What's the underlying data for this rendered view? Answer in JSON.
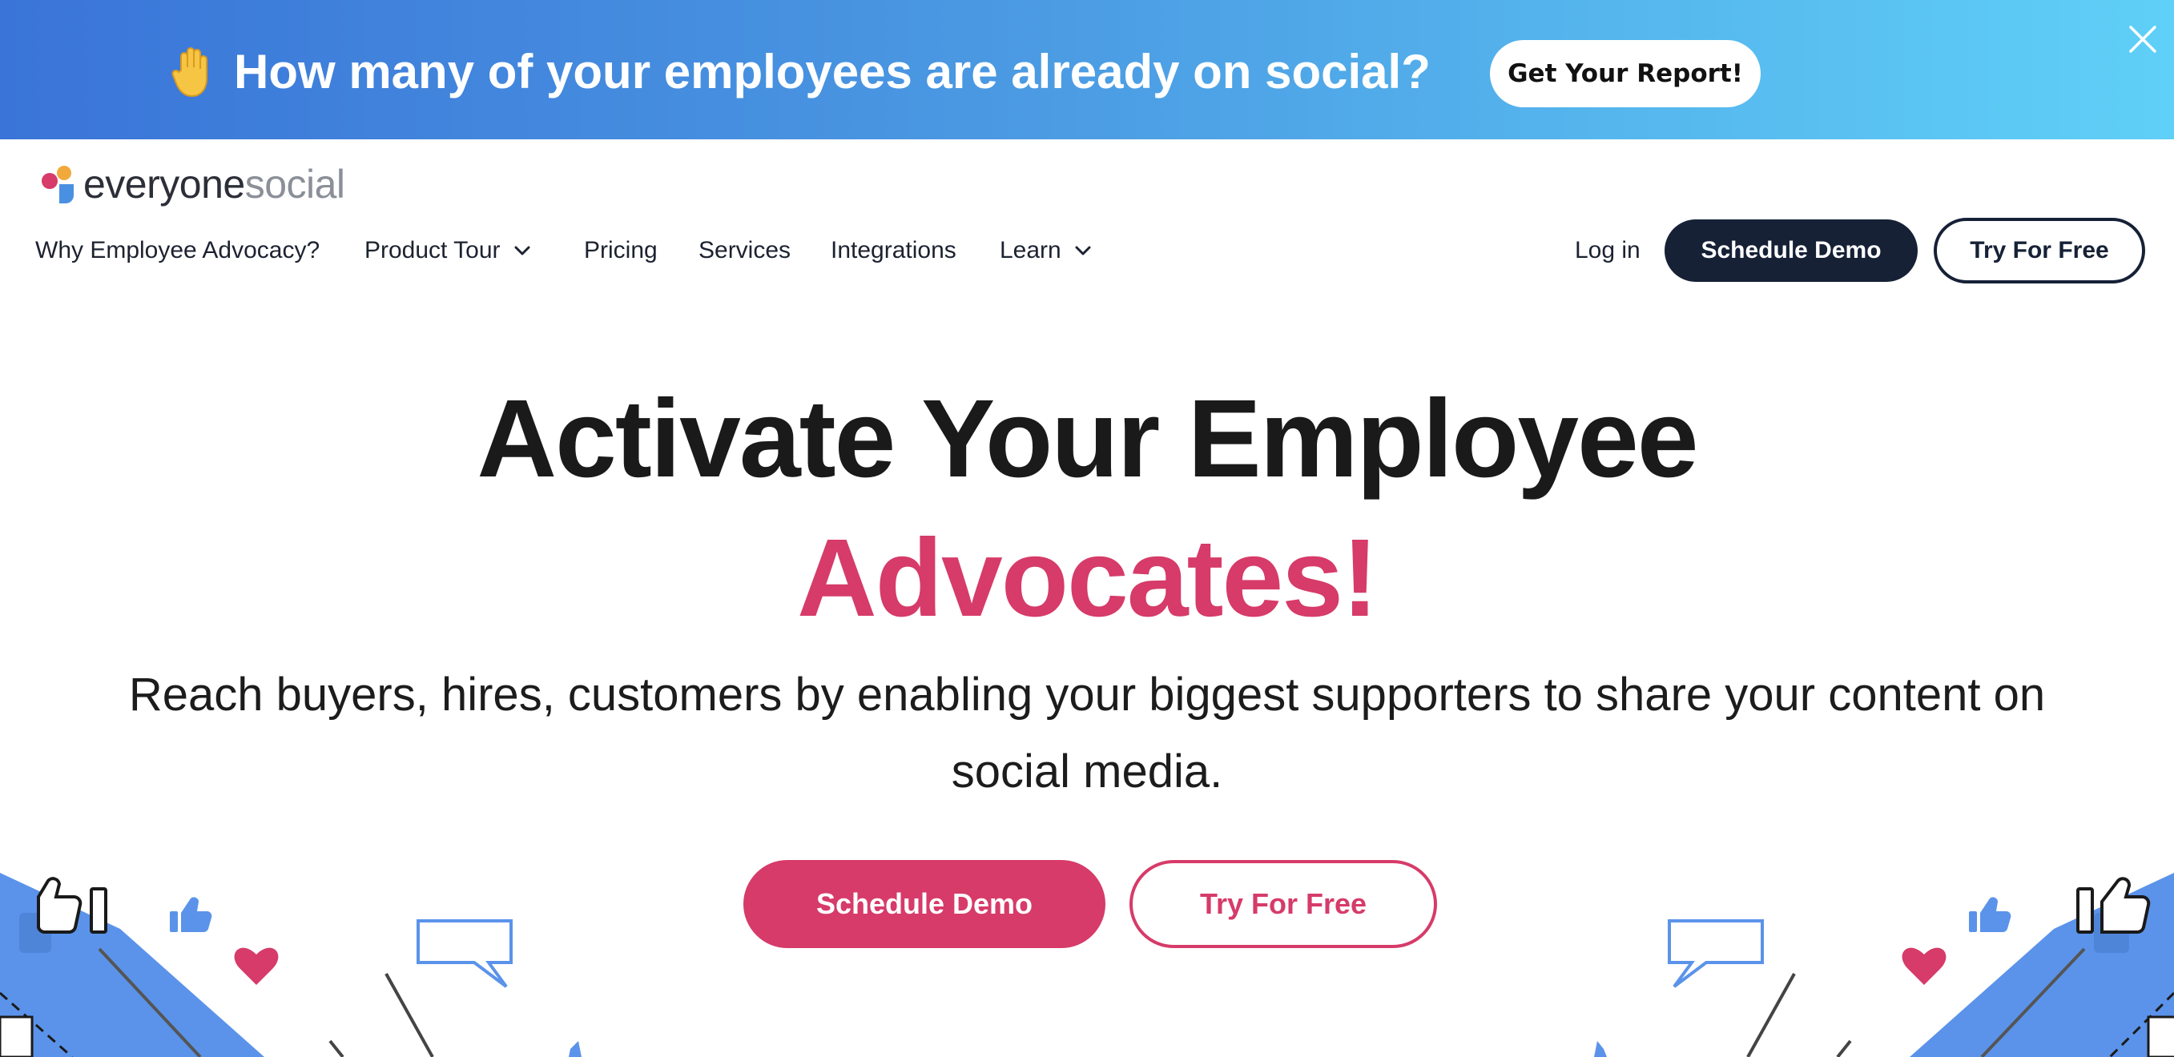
{
  "banner": {
    "emoji": "✋",
    "text": "How many of your employees are already on social?",
    "button_label": "Get Your Report!",
    "close_icon": "close-icon",
    "gradient_start": "#3a74d8",
    "gradient_end": "#5fd0f7"
  },
  "header": {
    "logo": {
      "part1": "everyone",
      "part2": "social"
    },
    "nav": [
      {
        "label": "Why Employee Advocacy?",
        "has_dropdown": false
      },
      {
        "label": "Product Tour",
        "has_dropdown": true
      },
      {
        "label": "Pricing",
        "has_dropdown": false
      },
      {
        "label": "Services",
        "has_dropdown": false
      },
      {
        "label": "Integrations",
        "has_dropdown": false
      },
      {
        "label": "Learn",
        "has_dropdown": true
      }
    ],
    "login_label": "Log in",
    "schedule_demo_label": "Schedule Demo",
    "try_free_label": "Try For Free"
  },
  "hero": {
    "title_line1": "Activate Your Employee",
    "title_line2": "Advocates!",
    "subtitle": "Reach buyers, hires, customers by enabling your biggest supporters to share your content on social media.",
    "primary_cta": "Schedule Demo",
    "secondary_cta": "Try For Free"
  },
  "colors": {
    "brand_pink": "#d63b69",
    "navy": "#162136",
    "illustration_blue": "#5b93ea"
  },
  "icons": [
    "raised-hand-icon",
    "close-icon",
    "chevron-down-icon",
    "thumbs-up-icon",
    "heart-icon",
    "speech-bubble-icon"
  ]
}
